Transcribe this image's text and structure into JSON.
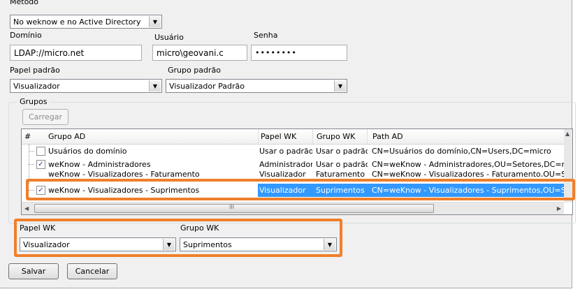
{
  "metodo": {
    "label": "Metodo",
    "value": "No weknow e no Active Directory"
  },
  "dominio": {
    "label": "Domínio",
    "value": "LDAP://micro.net"
  },
  "usuario": {
    "label": "Usuário",
    "value": "micro\\geovani.c"
  },
  "senha": {
    "label": "Senha",
    "value": "••••••••"
  },
  "papel_padrao": {
    "label": "Papel padrão",
    "value": "Visualizador"
  },
  "grupo_padrao": {
    "label": "Grupo padrão",
    "value": "Visualizador Padrão"
  },
  "grupos": {
    "label": "Grupos",
    "carregar": "Carregar",
    "columns": {
      "num": "#",
      "grupo_ad": "Grupo AD",
      "papel_wk": "Papel WK",
      "grupo_wk": "Grupo WK",
      "path_ad": "Path AD"
    },
    "rows": [
      {
        "checked": false,
        "grupo_ad": "Usuários do domínio",
        "papel_wk": "Usar o padrão",
        "grupo_wk": "Usar o padrão",
        "path_ad": "CN=Usuários do domínio,CN=Users,DC=micro"
      },
      {
        "checked": true,
        "grupo_ad": "weKnow - Administradores",
        "papel_wk": "Administrador",
        "grupo_wk": "Usar o padrão",
        "path_ad": "CN=weKnow - Administradores,OU=Setores,DC=n"
      },
      {
        "checked": true,
        "grupo_ad": "weKnow - Visualizadores - Faturamento",
        "papel_wk": "Visualizador",
        "grupo_wk": "Faturamento",
        "path_ad": "CN=weKnow - Visualizadores - Faturamento,OU=S"
      },
      {
        "checked": true,
        "grupo_ad": "weKnow - Visualizadores - Suprimentos",
        "papel_wk": "Visualizador",
        "grupo_wk": "Suprimentos",
        "path_ad": "CN=weKnow - Visualizadores - Suprimentos,OU=S"
      }
    ],
    "scroll_mark": "III"
  },
  "editor": {
    "papel_label": "Papel WK",
    "papel_value": "Visualizador",
    "grupo_label": "Grupo WK",
    "grupo_value": "Suprimentos"
  },
  "actions": {
    "salvar": "Salvar",
    "cancelar": "Cancelar"
  },
  "colors": {
    "highlight": "#f07f2c",
    "selection": "#3399ff"
  },
  "icons": {
    "dropdown": "chevron-down-icon",
    "check": "checkmark-icon"
  }
}
